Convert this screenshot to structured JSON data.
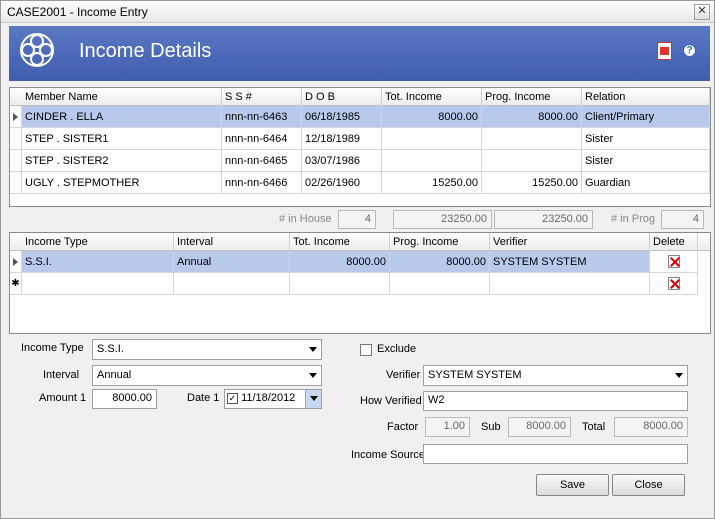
{
  "window": {
    "title": "CASE2001 - Income Entry",
    "close_glyph": "✕"
  },
  "banner": {
    "heading": "Income Details",
    "pdf_icon": "pdf-icon",
    "help_icon": "help-icon",
    "help_glyph": "?"
  },
  "members": {
    "columns": [
      "Member Name",
      "S S #",
      "D O B",
      "Tot. Income",
      "Prog. Income",
      "Relation"
    ],
    "rows": [
      [
        "CINDER . ELLA",
        "nnn-nn-6463",
        "06/18/1985",
        "8000.00",
        "8000.00",
        "Client/Primary"
      ],
      [
        "STEP . SISTER1",
        "nnn-nn-6464",
        "12/18/1989",
        "",
        "",
        "Sister"
      ],
      [
        "STEP . SISTER2",
        "nnn-nn-6465",
        "03/07/1986",
        "",
        "",
        "Sister"
      ],
      [
        "UGLY . STEPMOTHER",
        "nnn-nn-6466",
        "02/26/1960",
        "15250.00",
        "15250.00",
        "Guardian"
      ]
    ]
  },
  "totals": {
    "in_house_label": "# in House",
    "in_house": "4",
    "tot_income": "23250.00",
    "prog_income": "23250.00",
    "in_prog_label": "# in Prog",
    "in_prog": "4"
  },
  "income": {
    "columns": [
      "Income Type",
      "Interval",
      "Tot. Income",
      "Prog. Income",
      "Verifier",
      "Delete"
    ],
    "rows": [
      [
        "S.S.I.",
        "Annual",
        "8000.00",
        "8000.00",
        "SYSTEM  SYSTEM"
      ]
    ],
    "new_row_marker": "✱"
  },
  "form": {
    "income_type_label": "Income Type",
    "income_type": "S.S.I.",
    "interval_label": "Interval",
    "interval": "Annual",
    "amount1_label": "Amount 1",
    "amount1": "8000.00",
    "date1_label": "Date 1",
    "date1": "11/18/2012",
    "exclude_label": "Exclude",
    "verifier_label": "Verifier",
    "verifier": "SYSTEM  SYSTEM",
    "how_verified_label": "How Verified",
    "how_verified": "W2",
    "factor_label": "Factor",
    "factor": "1.00",
    "sub_label": "Sub",
    "sub": "8000.00",
    "total_label": "Total",
    "total": "8000.00",
    "income_source_label": "Income Source",
    "income_source": ""
  },
  "buttons": {
    "save": "Save",
    "close": "Close"
  }
}
